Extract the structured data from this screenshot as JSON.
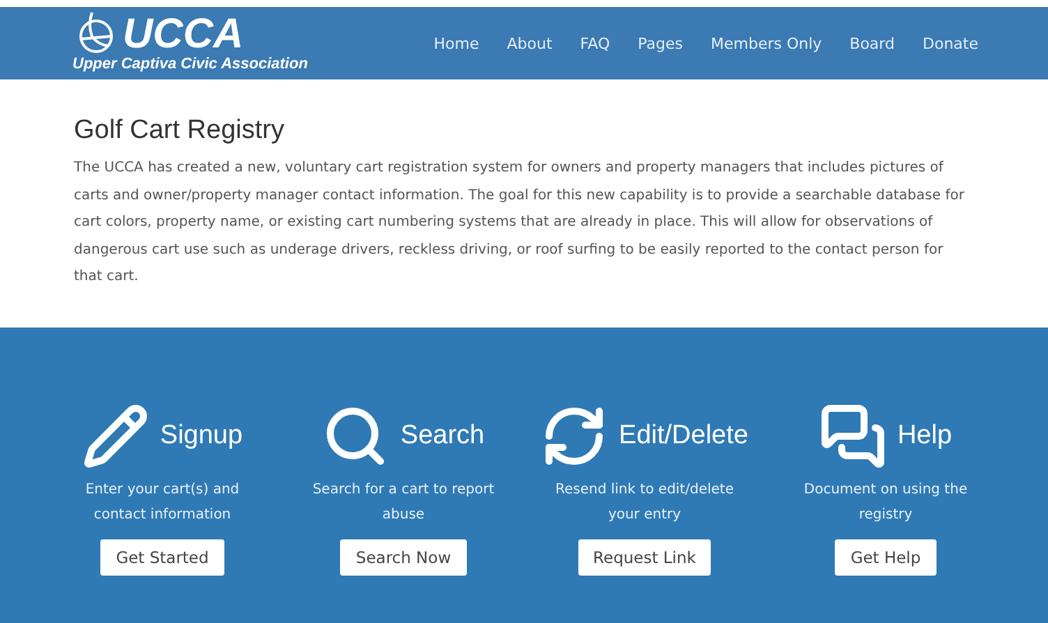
{
  "header": {
    "logo_title": "UCCA",
    "logo_subtitle": "Upper Captiva Civic Association",
    "nav": [
      {
        "label": "Home"
      },
      {
        "label": "About"
      },
      {
        "label": "FAQ"
      },
      {
        "label": "Pages"
      },
      {
        "label": "Members Only"
      },
      {
        "label": "Board"
      },
      {
        "label": "Donate"
      }
    ]
  },
  "intro": {
    "title": "Golf Cart Registry",
    "body": "The UCCA has created a new, voluntary cart registration system for owners and property managers that includes pictures of carts and owner/property manager contact information. The goal for this new capability is to provide a searchable database for cart colors, property name, or existing cart numbering systems that are already in place. This will allow for observations of dangerous cart use such as underage drivers, reckless driving, or roof surfing to be easily reported to the contact person for that cart."
  },
  "actions": [
    {
      "kind": "signup",
      "title": "Signup",
      "description": "Enter your cart(s) and contact information",
      "button": "Get Started"
    },
    {
      "kind": "search",
      "title": "Search",
      "description": "Search for a cart to report abuse",
      "button": "Search Now"
    },
    {
      "kind": "edit",
      "title": "Edit/Delete",
      "description": "Resend link to edit/delete your entry",
      "button": "Request Link"
    },
    {
      "kind": "help",
      "title": "Help",
      "description": "Document on using the registry",
      "button": "Get Help"
    }
  ]
}
